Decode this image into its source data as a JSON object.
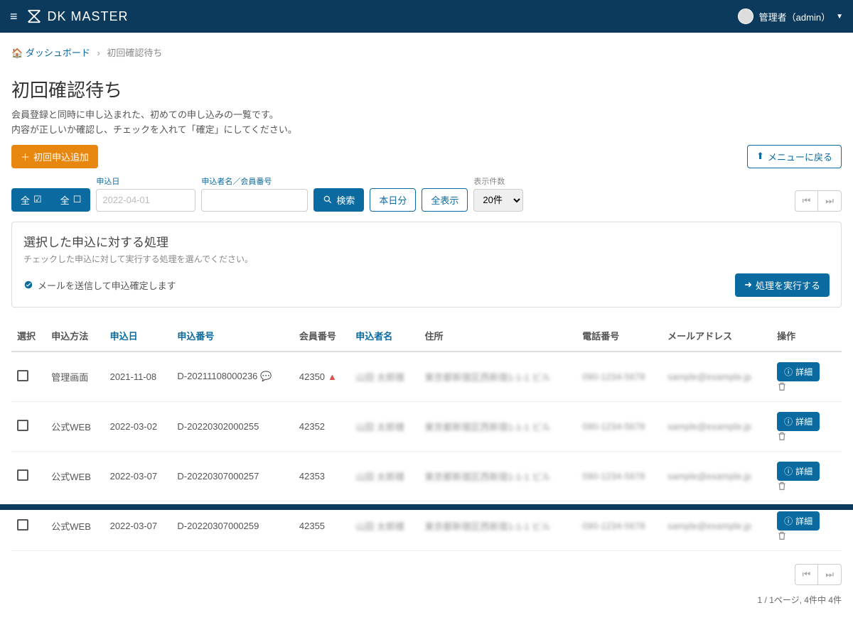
{
  "topbar": {
    "brand": "DK MASTER",
    "user_label": "管理者（admin）"
  },
  "breadcrumb": {
    "home": "ダッシュボード",
    "current": "初回確認待ち"
  },
  "page": {
    "title": "初回確認待ち",
    "desc_line1": "会員登録と同時に申し込まれた、初めての申し込みの一覧です。",
    "desc_line2": "内容が正しいか確認し、チェックを入れて「確定」にしてください。"
  },
  "buttons": {
    "add_first": "初回申込追加",
    "back_menu": "メニューに戻る",
    "search": "検索",
    "today": "本日分",
    "show_all": "全表示",
    "execute": "処理を実行する",
    "detail": "詳細",
    "select_all_on": "全",
    "select_all_off": "全"
  },
  "filters": {
    "date_label": "申込日",
    "date_placeholder": "2022-04-01",
    "name_label": "申込者名／会員番号",
    "count_label": "表示件数",
    "count_value": "20件"
  },
  "action_box": {
    "title": "選択した申込に対する処理",
    "desc": "チェックした申込に対して実行する処理を選んでください。",
    "option1": "メールを送信して申込確定します"
  },
  "table": {
    "headers": {
      "select": "選択",
      "method": "申込方法",
      "date": "申込日",
      "number": "申込番号",
      "member": "会員番号",
      "name": "申込者名",
      "address": "住所",
      "phone": "電話番号",
      "email": "メールアドレス",
      "action": "操作"
    },
    "rows": [
      {
        "method": "管理画面",
        "date": "2021-11-08",
        "number": "D-20211108000236",
        "has_comment": true,
        "member": "42350",
        "has_warn": true
      },
      {
        "method": "公式WEB",
        "date": "2022-03-02",
        "number": "D-20220302000255",
        "has_comment": false,
        "member": "42352",
        "has_warn": false
      },
      {
        "method": "公式WEB",
        "date": "2022-03-07",
        "number": "D-20220307000257",
        "has_comment": false,
        "member": "42353",
        "has_warn": false
      },
      {
        "method": "公式WEB",
        "date": "2022-03-07",
        "number": "D-20220307000259",
        "has_comment": false,
        "member": "42355",
        "has_warn": false
      }
    ]
  },
  "footer": {
    "info": "1 / 1ページ, 4件中 4件"
  }
}
